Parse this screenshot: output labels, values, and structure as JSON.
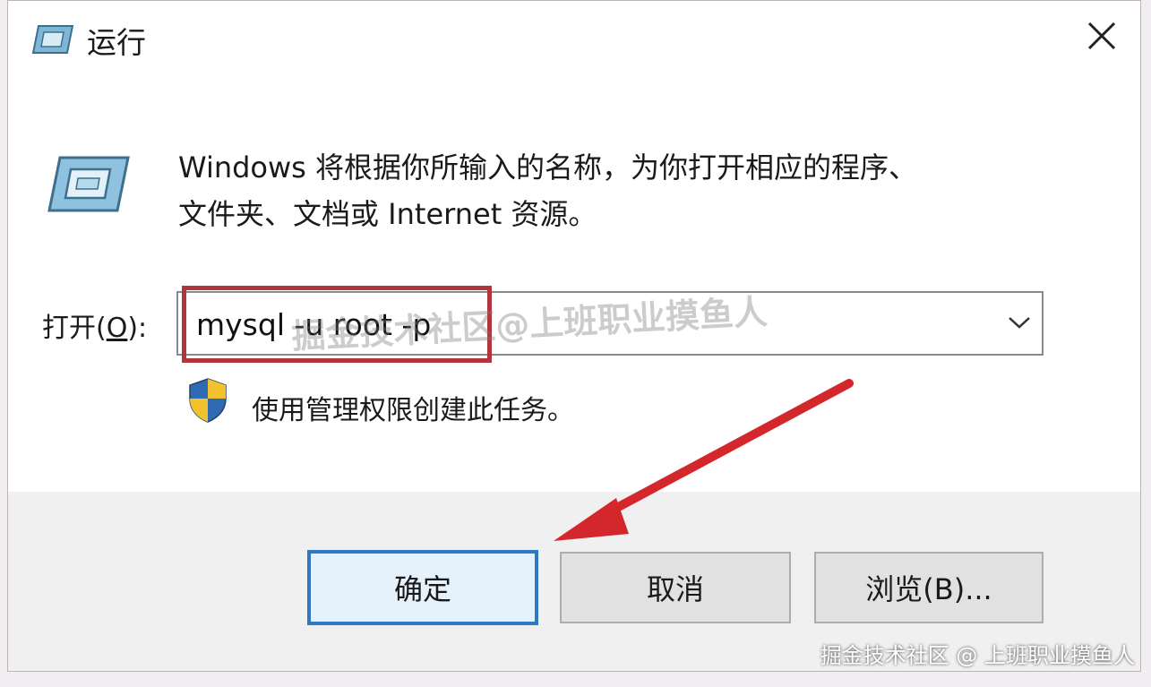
{
  "window": {
    "title": "运行",
    "close_symbol": "✕"
  },
  "description": {
    "line1": "Windows 将根据你所输入的名称，为你打开相应的程序、",
    "line2": "文件夹、文档或 Internet 资源。"
  },
  "open_field": {
    "label_prefix": "打开(",
    "label_hotkey": "O",
    "label_suffix": "):",
    "value": "mysql -u root -p"
  },
  "admin_notice": "使用管理权限创建此任务。",
  "buttons": {
    "ok": "确定",
    "cancel": "取消",
    "browse": "浏览(B)..."
  },
  "watermarks": {
    "center": "掘金技术社区@上班职业摸鱼人",
    "corner": "掘金技术社区 @ 上班职业摸鱼人"
  },
  "icons": {
    "title": "run-icon",
    "large": "run-icon",
    "shield": "uac-shield-icon",
    "dropdown": "chevron-down-icon",
    "close": "close-icon"
  },
  "colors": {
    "highlight_box": "#b1353d",
    "annotation_arrow": "#d4272c",
    "default_button_border": "#2f78c4"
  }
}
